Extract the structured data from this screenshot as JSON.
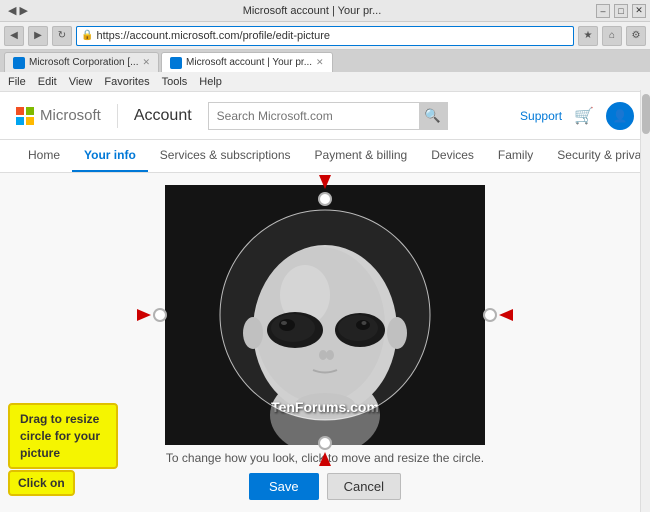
{
  "window": {
    "title": "Microsoft account | Your pr...",
    "url": "https://account.microsoft.com/profile/edit-picture",
    "url_display": "https://account.microsoft.com/profile/edit-picture",
    "minimize": "–",
    "maximize": "□",
    "close": "✕"
  },
  "tabs": [
    {
      "label": "Microsoft Corporation [...",
      "active": false
    },
    {
      "label": "Microsoft account | Your pr...",
      "active": true
    }
  ],
  "menu": {
    "items": [
      "File",
      "Edit",
      "View",
      "Favorites",
      "Tools",
      "Help"
    ]
  },
  "header": {
    "logo_text": "Microsoft",
    "divider": "|",
    "account_label": "Account",
    "search_placeholder": "Search Microsoft.com",
    "support_label": "Support",
    "avatar_label": "👤"
  },
  "nav": {
    "tabs": [
      {
        "label": "Home",
        "active": false
      },
      {
        "label": "Your info",
        "active": true
      },
      {
        "label": "Services & subscriptions",
        "active": false
      },
      {
        "label": "Payment & billing",
        "active": false
      },
      {
        "label": "Devices",
        "active": false
      },
      {
        "label": "Family",
        "active": false
      },
      {
        "label": "Security & privacy",
        "active": false
      }
    ]
  },
  "editor": {
    "watermark": "TenForums.com",
    "instruction": "To change how you look, click to move and resize the circle.",
    "tooltip_drag": "Drag to resize circle for your picture",
    "tooltip_click": "Click on",
    "save_label": "Save",
    "cancel_label": "Cancel"
  },
  "colors": {
    "accent": "#0078d7",
    "tooltip_bg": "#f5f500",
    "arrow": "#cc0000"
  }
}
